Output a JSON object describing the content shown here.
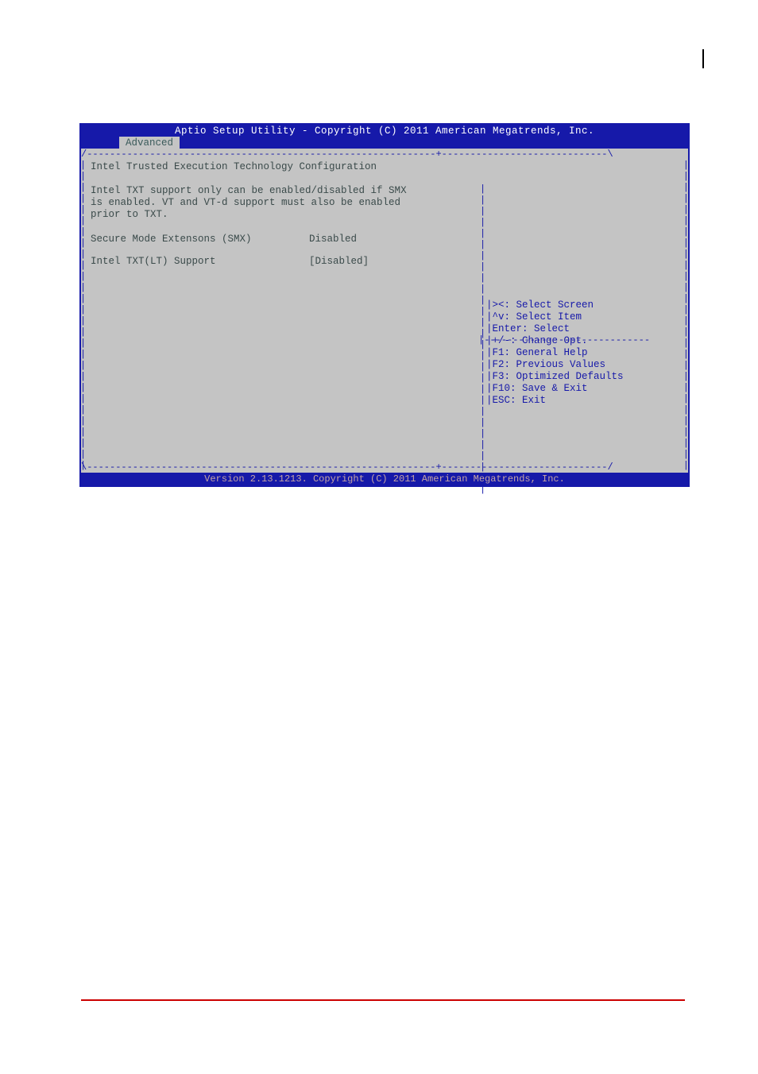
{
  "header": {
    "title": "Aptio Setup Utility - Copyright (C) 2011 American Megatrends, Inc.",
    "tab": "Advanced"
  },
  "left": {
    "title": "Intel Trusted Execution Technology Configuration",
    "description": "Intel TXT support only can be enabled/disabled if SMX\nis enabled. VT and VT-d support must also be enabled\nprior to TXT.",
    "settings": [
      {
        "label": "Secure Mode Extensons (SMX)",
        "value": "Disabled"
      },
      {
        "label": "Intel TXT(LT) Support",
        "value": "[Disabled]"
      }
    ]
  },
  "right": {
    "help": "|><: Select Screen\n|^v: Select Item\n|Enter: Select\n|+/-: Change Opt.\n|F1: General Help\n|F2: Previous Values\n|F3: Optimized Defaults\n|F10: Save & Exit\n|ESC: Exit"
  },
  "footer": {
    "version": "Version 2.13.1213. Copyright (C) 2011 American Megatrends, Inc."
  },
  "borders": {
    "top": "/-------------------------------------------------------------+-----------------------------\\",
    "mid": "|-----------------------------",
    "bottom": "\\-------------------------------------------------------------+-----------------------------/",
    "pipes": "|\n|\n|\n|\n|\n|\n|\n|\n|\n|\n|\n|\n|\n|\n|\n|\n|\n|\n|\n|\n|\n|\n|\n|\n|\n|\n|\n|"
  }
}
